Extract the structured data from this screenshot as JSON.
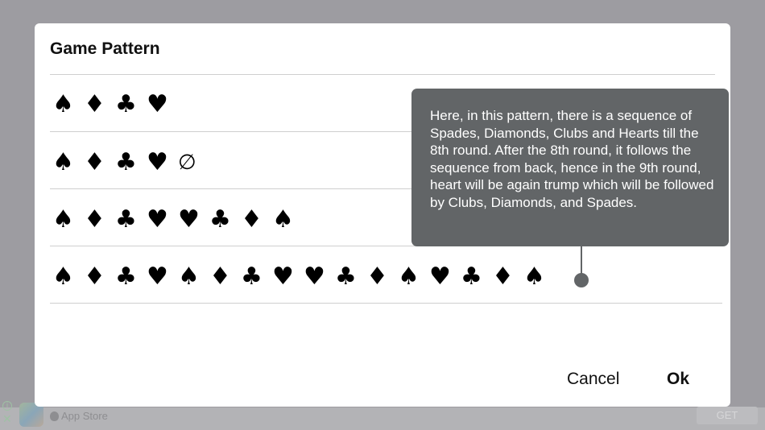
{
  "background_ad": {
    "info_symbol": "i",
    "close_symbol": "✕",
    "store_label": "App Store",
    "get_label": "GET"
  },
  "dialog": {
    "title": "Game Pattern",
    "rows": [
      [
        "♠",
        "♦",
        "♣",
        "♥"
      ],
      [
        "♠",
        "♦",
        "♣",
        "♥",
        "∅"
      ],
      [
        "♠",
        "♦",
        "♣",
        "♥",
        "♥",
        "♣",
        "♦",
        "♠"
      ],
      [
        "♠",
        "♦",
        "♣",
        "♥",
        "♠",
        "♦",
        "♣",
        "♥",
        "♥",
        "♣",
        "♦",
        "♠",
        "♥",
        "♣",
        "♦",
        "♠"
      ]
    ],
    "cancel_label": "Cancel",
    "ok_label": "Ok"
  },
  "tooltip": {
    "text": "Here, in this pattern, there is a sequence of Spades, Diamonds, Clubs and Hearts till the 8th round. After the 8th round,  it follows the sequence from back, hence in the 9th round, heart will be again trump which will be followed by Clubs, Diamonds, and Spades."
  },
  "colors": {
    "overlay": "#9d9ca1",
    "dialog_bg": "#ffffff",
    "tooltip_bg": "#626567",
    "divider": "#cfcfcf"
  }
}
